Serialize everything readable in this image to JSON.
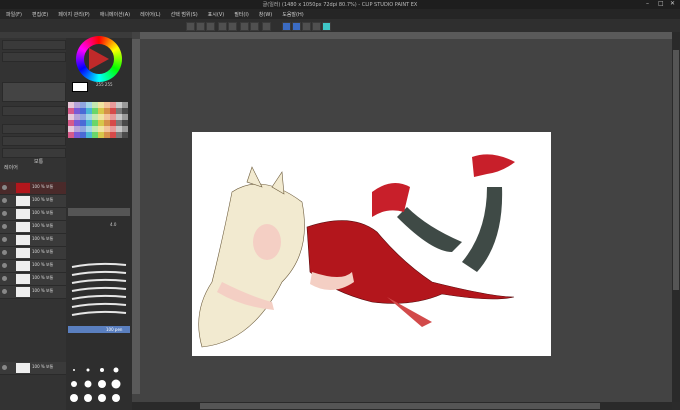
{
  "window": {
    "title": "글(일러) (1480 x 1050px 72dpi 80.7%) - CLIP STUDIO PAINT EX"
  },
  "menu": [
    "파일(F)",
    "편집(E)",
    "페이지 관리(P)",
    "애니메이션(A)",
    "레이어(L)",
    "선택 범위(S)",
    "표시(V)",
    "필터(I)",
    "창(W)",
    "도움말(H)"
  ],
  "left_panel": {
    "layer_color_value": "255 255",
    "layer_section_label": "레이어",
    "blend_label": "보통",
    "layers": [
      {
        "name": "100 % 보통",
        "sub": "레이어 1"
      },
      {
        "name": "100 % 보통",
        "sub": "레이어 2"
      },
      {
        "name": "100 % 보통",
        "sub": "레이어 3"
      },
      {
        "name": "100 % 보통",
        "sub": "레이어 4"
      },
      {
        "name": "100 % 보통",
        "sub": "레이어 5"
      },
      {
        "name": "100 % 보통",
        "sub": "레이어 6"
      },
      {
        "name": "100 % 보통",
        "sub": "레이어 7"
      },
      {
        "name": "100 % 보통",
        "sub": "레이어 8"
      },
      {
        "name": "100 % 보통",
        "sub": "레이어 9"
      },
      {
        "name": "100 % 보통",
        "sub": "용지"
      }
    ],
    "brush_size_value": "4.0",
    "brush_size_label": "100 pen"
  },
  "colors": {
    "workspace": "#434343",
    "canvas": "#ffffff",
    "accent": "#3b6bc2",
    "dress_red": "#b3161c"
  }
}
